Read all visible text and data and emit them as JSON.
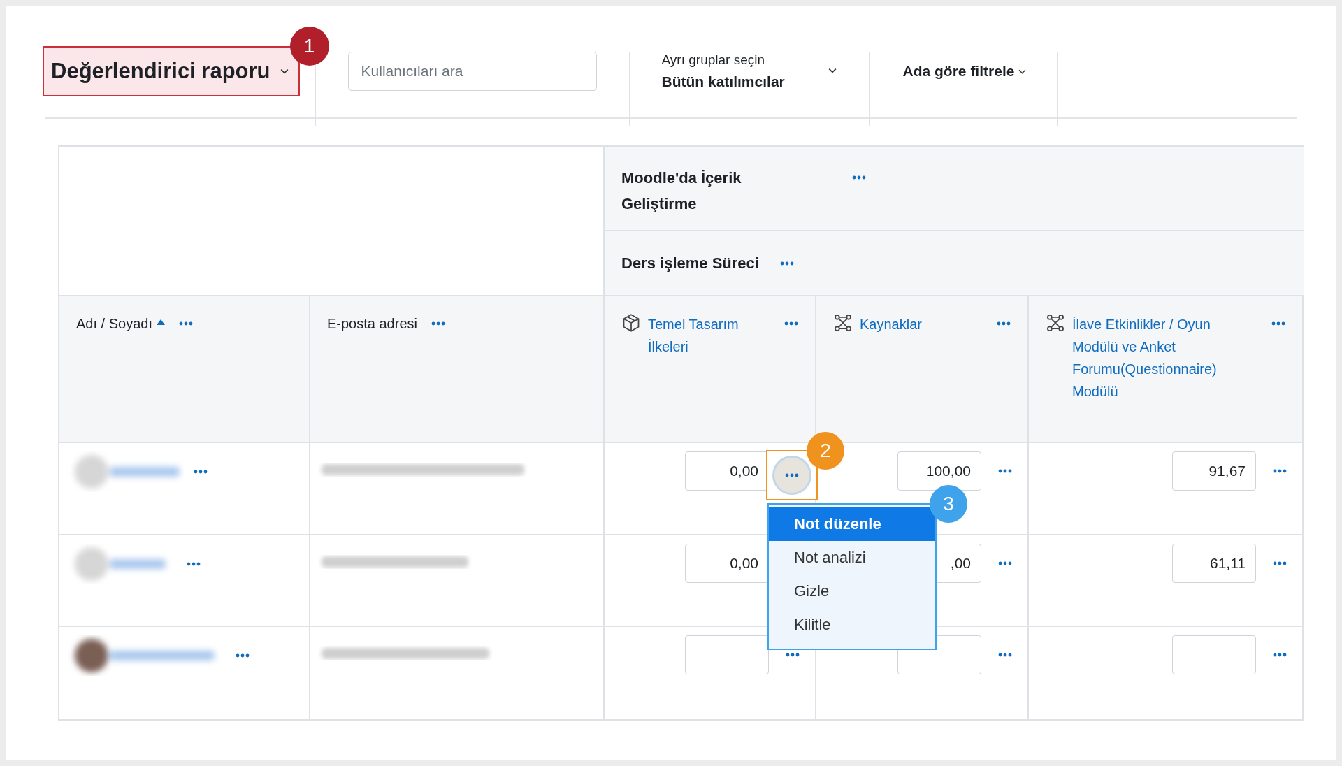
{
  "report_selector": {
    "label": "Değerlendirici raporu",
    "callout": "1"
  },
  "search": {
    "placeholder": "Kullanıcıları ara"
  },
  "groups": {
    "label": "Ayrı gruplar seçin",
    "value": "Bütün katılımcılar"
  },
  "name_filter": {
    "label": "Ada göre filtrele"
  },
  "category": {
    "title": "Moodle'da İçerik Geliştirme"
  },
  "subcategory": {
    "title": "Ders işleme Süreci"
  },
  "columns": [
    {
      "label": "Adı / Soyadı",
      "sorted": true
    },
    {
      "label": "E-posta adresi",
      "sorted": false
    },
    {
      "label": "Temel Tasarım İlkeleri",
      "kind": "assignment"
    },
    {
      "label": "Kaynaklar",
      "kind": "module"
    },
    {
      "label": "İlave Etkinlikler / Oyun Modülü ve Anket Forumu(Questionnaire) Modülü",
      "kind": "module"
    }
  ],
  "rows": [
    {
      "grades": [
        {
          "value": "0,00",
          "focused": true
        },
        {
          "value": "100,00",
          "focused": false
        },
        {
          "value": "91,67",
          "focused": false
        }
      ]
    },
    {
      "grades": [
        {
          "value": "0,00",
          "focused": false
        },
        {
          "value": ",00",
          "focused": false
        },
        {
          "value": "61,11",
          "focused": false
        }
      ]
    },
    {
      "grades": [
        {
          "focused": false
        },
        {
          "focused": false
        },
        {
          "focused": false
        }
      ]
    }
  ],
  "action_menu": {
    "callouts": [
      "2",
      "3"
    ],
    "items": [
      {
        "label": "Not düzenle",
        "selected": true
      },
      {
        "label": "Not analizi",
        "selected": false
      },
      {
        "label": "Gizle",
        "selected": false
      },
      {
        "label": "Kilitle",
        "selected": false
      }
    ]
  }
}
